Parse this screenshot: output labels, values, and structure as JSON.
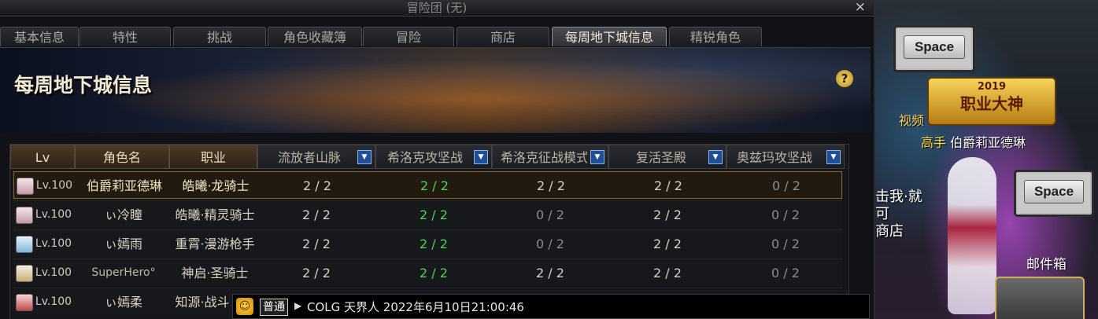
{
  "window": {
    "title": "冒险团 (无)",
    "close_label": "×"
  },
  "tabs": [
    {
      "label": "基本信息"
    },
    {
      "label": "特性"
    },
    {
      "label": "挑战"
    },
    {
      "label": "角色收藏簿"
    },
    {
      "label": "冒险"
    },
    {
      "label": "商店"
    },
    {
      "label": "每周地下城信息",
      "active": true
    },
    {
      "label": "精锐角色"
    }
  ],
  "page": {
    "heading": "每周地下城信息",
    "help_label": "?"
  },
  "table": {
    "headers": {
      "lv": "Lv",
      "name": "角色名",
      "job": "职业",
      "d1": "流放者山脉",
      "d2": "希洛克攻坚战",
      "d3": "希洛克征战模式",
      "d4": "复活圣殿",
      "d5": "奥兹玛攻坚战"
    },
    "dropdown_icon": "chevron-down-icon",
    "rows": [
      {
        "lv": "Lv.100",
        "name": "伯爵莉亚德琳",
        "job": "皓曦·龙骑士",
        "d1": "2 / 2",
        "d2": "2 / 2",
        "d3": "2 / 2",
        "d4": "2 / 2",
        "d5": "0 / 2",
        "selected": true
      },
      {
        "lv": "Lv.100",
        "name": "ぃ冷瞳",
        "job": "皓曦·精灵骑士",
        "d1": "2 / 2",
        "d2": "2 / 2",
        "d3": "0 / 2",
        "d4": "2 / 2",
        "d5": "0 / 2"
      },
      {
        "lv": "Lv.100",
        "name": "ぃ嫣雨",
        "job": "重霄·漫游枪手",
        "d1": "2 / 2",
        "d2": "2 / 2",
        "d3": "0 / 2",
        "d4": "2 / 2",
        "d5": "0 / 2"
      },
      {
        "lv": "Lv.100",
        "name": "SuperHero°",
        "job": "神启·圣骑士",
        "d1": "2 / 2",
        "d2": "2 / 2",
        "d3": "2 / 2",
        "d4": "2 / 2",
        "d5": "0 / 2"
      },
      {
        "lv": "Lv.100",
        "name": "ぃ嫣柔",
        "job": "知源·战斗",
        "d1": "",
        "d2": "",
        "d3": "",
        "d4": "",
        "d5": ""
      }
    ]
  },
  "chat": {
    "mode": "普通",
    "message": "COLG 天界人 2022年6月10日21:00:46"
  },
  "scene": {
    "space_key_1": "Space",
    "space_key_2": "Space",
    "medal_year": "2019",
    "medal_text": "职业大神",
    "player_rank": "高手",
    "player_name": "伯爵莉亚德琳",
    "video_label": "视频",
    "npc_text": "击我·就可\n商店",
    "mailbox_label": "邮件箱"
  },
  "colors": {
    "accent_gold": "#8a6a2c",
    "active_count_green": "#4cd64c",
    "header_brown": "#4a3a26",
    "dropdown_blue": "#1f4f96"
  }
}
